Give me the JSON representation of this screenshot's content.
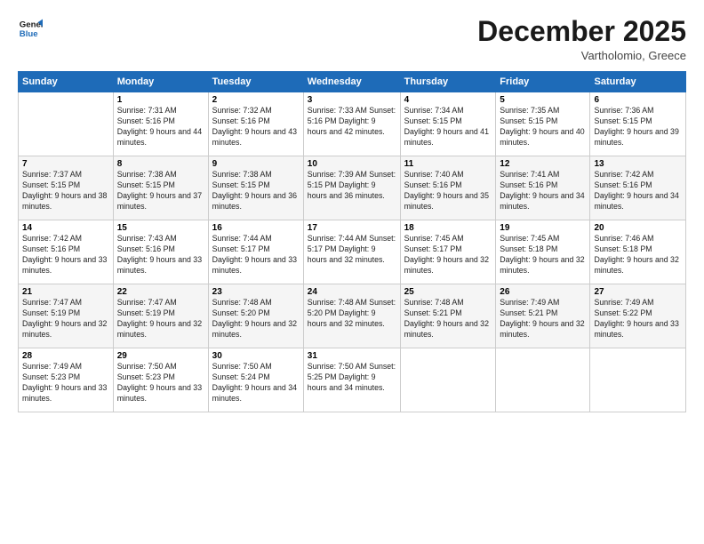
{
  "logo": {
    "line1": "General",
    "line2": "Blue"
  },
  "title": "December 2025",
  "subtitle": "Vartholomio, Greece",
  "days_header": [
    "Sunday",
    "Monday",
    "Tuesday",
    "Wednesday",
    "Thursday",
    "Friday",
    "Saturday"
  ],
  "weeks": [
    [
      {
        "num": "",
        "info": ""
      },
      {
        "num": "1",
        "info": "Sunrise: 7:31 AM\nSunset: 5:16 PM\nDaylight: 9 hours\nand 44 minutes."
      },
      {
        "num": "2",
        "info": "Sunrise: 7:32 AM\nSunset: 5:16 PM\nDaylight: 9 hours\nand 43 minutes."
      },
      {
        "num": "3",
        "info": "Sunrise: 7:33 AM\nSunset: 5:16 PM\nDaylight: 9 hours\nand 42 minutes."
      },
      {
        "num": "4",
        "info": "Sunrise: 7:34 AM\nSunset: 5:15 PM\nDaylight: 9 hours\nand 41 minutes."
      },
      {
        "num": "5",
        "info": "Sunrise: 7:35 AM\nSunset: 5:15 PM\nDaylight: 9 hours\nand 40 minutes."
      },
      {
        "num": "6",
        "info": "Sunrise: 7:36 AM\nSunset: 5:15 PM\nDaylight: 9 hours\nand 39 minutes."
      }
    ],
    [
      {
        "num": "7",
        "info": "Sunrise: 7:37 AM\nSunset: 5:15 PM\nDaylight: 9 hours\nand 38 minutes."
      },
      {
        "num": "8",
        "info": "Sunrise: 7:38 AM\nSunset: 5:15 PM\nDaylight: 9 hours\nand 37 minutes."
      },
      {
        "num": "9",
        "info": "Sunrise: 7:38 AM\nSunset: 5:15 PM\nDaylight: 9 hours\nand 36 minutes."
      },
      {
        "num": "10",
        "info": "Sunrise: 7:39 AM\nSunset: 5:15 PM\nDaylight: 9 hours\nand 36 minutes."
      },
      {
        "num": "11",
        "info": "Sunrise: 7:40 AM\nSunset: 5:16 PM\nDaylight: 9 hours\nand 35 minutes."
      },
      {
        "num": "12",
        "info": "Sunrise: 7:41 AM\nSunset: 5:16 PM\nDaylight: 9 hours\nand 34 minutes."
      },
      {
        "num": "13",
        "info": "Sunrise: 7:42 AM\nSunset: 5:16 PM\nDaylight: 9 hours\nand 34 minutes."
      }
    ],
    [
      {
        "num": "14",
        "info": "Sunrise: 7:42 AM\nSunset: 5:16 PM\nDaylight: 9 hours\nand 33 minutes."
      },
      {
        "num": "15",
        "info": "Sunrise: 7:43 AM\nSunset: 5:16 PM\nDaylight: 9 hours\nand 33 minutes."
      },
      {
        "num": "16",
        "info": "Sunrise: 7:44 AM\nSunset: 5:17 PM\nDaylight: 9 hours\nand 33 minutes."
      },
      {
        "num": "17",
        "info": "Sunrise: 7:44 AM\nSunset: 5:17 PM\nDaylight: 9 hours\nand 32 minutes."
      },
      {
        "num": "18",
        "info": "Sunrise: 7:45 AM\nSunset: 5:17 PM\nDaylight: 9 hours\nand 32 minutes."
      },
      {
        "num": "19",
        "info": "Sunrise: 7:45 AM\nSunset: 5:18 PM\nDaylight: 9 hours\nand 32 minutes."
      },
      {
        "num": "20",
        "info": "Sunrise: 7:46 AM\nSunset: 5:18 PM\nDaylight: 9 hours\nand 32 minutes."
      }
    ],
    [
      {
        "num": "21",
        "info": "Sunrise: 7:47 AM\nSunset: 5:19 PM\nDaylight: 9 hours\nand 32 minutes."
      },
      {
        "num": "22",
        "info": "Sunrise: 7:47 AM\nSunset: 5:19 PM\nDaylight: 9 hours\nand 32 minutes."
      },
      {
        "num": "23",
        "info": "Sunrise: 7:48 AM\nSunset: 5:20 PM\nDaylight: 9 hours\nand 32 minutes."
      },
      {
        "num": "24",
        "info": "Sunrise: 7:48 AM\nSunset: 5:20 PM\nDaylight: 9 hours\nand 32 minutes."
      },
      {
        "num": "25",
        "info": "Sunrise: 7:48 AM\nSunset: 5:21 PM\nDaylight: 9 hours\nand 32 minutes."
      },
      {
        "num": "26",
        "info": "Sunrise: 7:49 AM\nSunset: 5:21 PM\nDaylight: 9 hours\nand 32 minutes."
      },
      {
        "num": "27",
        "info": "Sunrise: 7:49 AM\nSunset: 5:22 PM\nDaylight: 9 hours\nand 33 minutes."
      }
    ],
    [
      {
        "num": "28",
        "info": "Sunrise: 7:49 AM\nSunset: 5:23 PM\nDaylight: 9 hours\nand 33 minutes."
      },
      {
        "num": "29",
        "info": "Sunrise: 7:50 AM\nSunset: 5:23 PM\nDaylight: 9 hours\nand 33 minutes."
      },
      {
        "num": "30",
        "info": "Sunrise: 7:50 AM\nSunset: 5:24 PM\nDaylight: 9 hours\nand 34 minutes."
      },
      {
        "num": "31",
        "info": "Sunrise: 7:50 AM\nSunset: 5:25 PM\nDaylight: 9 hours\nand 34 minutes."
      },
      {
        "num": "",
        "info": ""
      },
      {
        "num": "",
        "info": ""
      },
      {
        "num": "",
        "info": ""
      }
    ]
  ]
}
